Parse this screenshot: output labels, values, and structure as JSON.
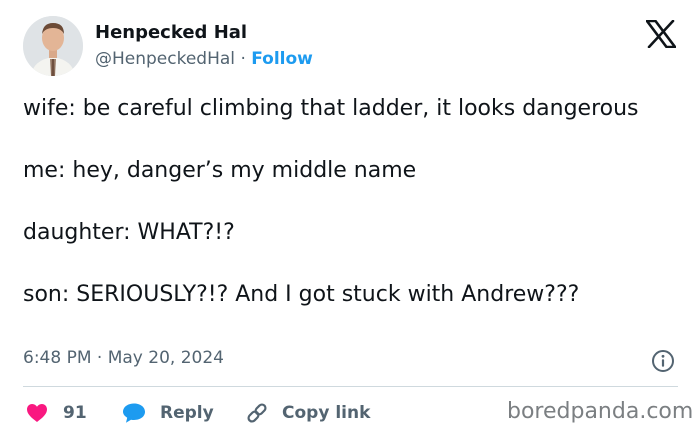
{
  "author": {
    "name": "Henpecked Hal",
    "handle": "@HenpeckedHal",
    "separator": "·",
    "follow_label": "Follow"
  },
  "tweet": {
    "paragraphs": [
      "wife: be careful climbing that ladder, it looks dangerous",
      "me: hey, danger’s my middle name",
      "daughter: WHAT?!?",
      "son: SERIOUSLY?!? And I got stuck with Andrew???"
    ],
    "time": "6:48 PM",
    "separator": "·",
    "date": "May 20, 2024"
  },
  "actions": {
    "like_count": "91",
    "reply_label": "Reply",
    "copy_link_label": "Copy link"
  },
  "icons": {
    "logo": "x-logo-icon",
    "info": "info-icon",
    "like": "heart-icon",
    "reply": "speech-bubble-icon",
    "copy_link": "link-icon"
  },
  "colors": {
    "like": "#f91880",
    "reply": "#1d9bf0",
    "follow": "#1d9bf0",
    "secondary_text": "#536471"
  },
  "watermark": "boredpanda.com"
}
